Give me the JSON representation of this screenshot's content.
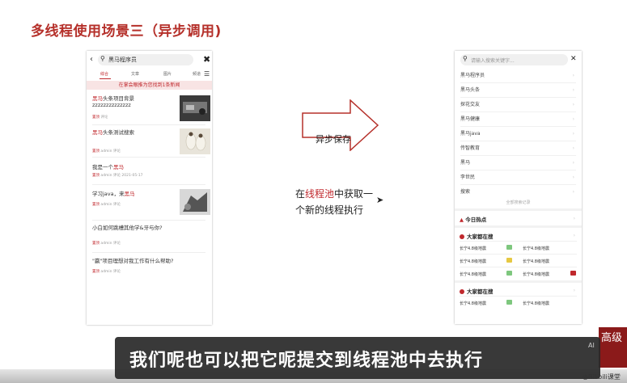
{
  "slide_title": "多线程使用场景三（异步调用)",
  "left_phone": {
    "back_icon": "arrow-left-icon",
    "search_query": "黑马程序员",
    "close_icon": "close-icon",
    "menu_icon": "menu-icon",
    "tabs": [
      {
        "label": "综合"
      },
      {
        "label": "文章"
      },
      {
        "label": "图片"
      },
      {
        "label": "频道"
      }
    ],
    "banner": "在掌会眼推为您找到1条新闻",
    "news": [
      {
        "title_hl": "黑马",
        "title_rest": "头条项目背景\nzzzzzzzzzzzzzz",
        "source": "置顶",
        "meta": "  评论",
        "has_thumb": true
      },
      {
        "title_hl": "黑马",
        "title_rest": "头条测试搜索",
        "source": "置顶",
        "meta": "  admin  评论",
        "has_thumb": true
      },
      {
        "title_pre": "我是一个",
        "title_hl": "黑马",
        "title_rest": "",
        "source": "置顶",
        "meta": "  admin  评论  2021-05-17",
        "has_thumb": false
      },
      {
        "title_pre": "学习java，来",
        "title_hl": "黑马",
        "title_rest": "",
        "source": "置顶",
        "meta": "  admin  评论",
        "has_thumb": true
      },
      {
        "title_pre": "小白如何跳槽其他学&牙与你?",
        "title_hl": "",
        "title_rest": "",
        "source": "置顶",
        "meta": "  admin  评论",
        "has_thumb": false
      },
      {
        "title_pre": "\"赢\"项目理想对我工作有什么帮助?",
        "title_hl": "",
        "title_rest": "",
        "source": "置顶",
        "meta": "  admin  评论",
        "has_thumb": false
      }
    ]
  },
  "arrow_label": "异步保存",
  "description": {
    "line1_pre": "在",
    "line1_hl": "线程池",
    "line1_post": "中获取一",
    "line2": "个新的线程执行"
  },
  "right_phone": {
    "search_icon": "search-icon",
    "placeholder": "请输入搜索关键字...",
    "close_icon": "close-icon",
    "history": [
      "黑马程序员",
      "黑马头条",
      "探花交友",
      "黑马健康",
      "黑马java",
      "传智教育",
      "黑马",
      "李世民",
      "搜索"
    ],
    "clear_label": "全部搜索记录",
    "today_label": "今日热点",
    "hot1_label": "大家都在搜",
    "hot1_items": [
      [
        "长宁4.8级地震",
        "长宁4.8级地震"
      ],
      [
        "长宁4.8级地震",
        "长宁4.8级地震"
      ],
      [
        "长宁4.8级地震",
        "长宁4.8级地震"
      ]
    ],
    "hot2_label": "大家都在搜",
    "hot2_items": [
      [
        "长宁4.8级地震",
        "长宁4.8级地震"
      ]
    ],
    "badge_colors": [
      "#7ec77e",
      "#e6c842",
      "#c0282d"
    ]
  },
  "subtitle": "我们呢也可以把它呢提交到线程池中去执行",
  "subtitle_ai": "AI",
  "corner_tag": "高级",
  "watermark": "◎Bilibili课堂",
  "colors": {
    "accent": "#b5302a",
    "red": "#c0282d"
  }
}
